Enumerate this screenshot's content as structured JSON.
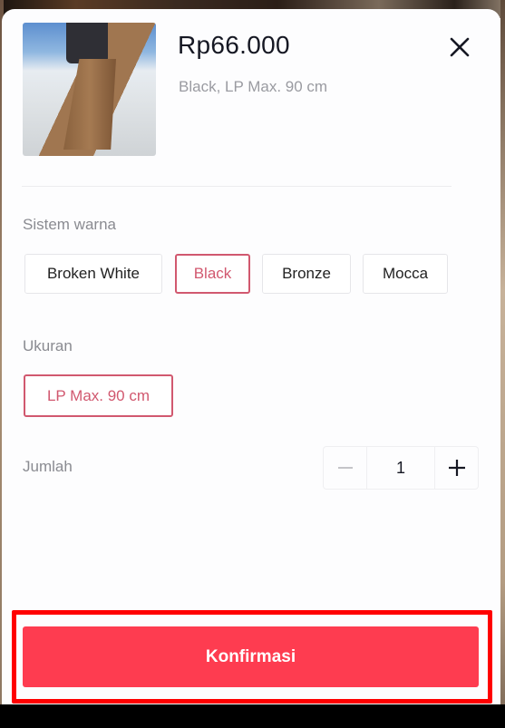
{
  "product": {
    "price": "Rp66.000",
    "selected_variant_summary": "Black, LP Max. 90 cm",
    "thumbnail_alt": "Product photo: brown pleated skirt"
  },
  "color_section": {
    "label": "Sistem warna",
    "options": [
      {
        "label": "Broken White",
        "selected": false
      },
      {
        "label": "Black",
        "selected": true
      },
      {
        "label": "Bronze",
        "selected": false
      },
      {
        "label": "Mocca",
        "selected": false
      }
    ]
  },
  "size_section": {
    "label": "Ukuran",
    "options": [
      {
        "label": "LP Max. 90 cm",
        "selected": true
      }
    ]
  },
  "quantity": {
    "label": "Jumlah",
    "value": "1",
    "decrement_icon": "minus-icon",
    "increment_icon": "plus-icon"
  },
  "actions": {
    "close_icon": "close-icon",
    "confirm_label": "Konfirmasi"
  },
  "colors": {
    "accent": "#fe3c50",
    "selected_border": "#d1586f",
    "highlight": "#ff0000"
  }
}
